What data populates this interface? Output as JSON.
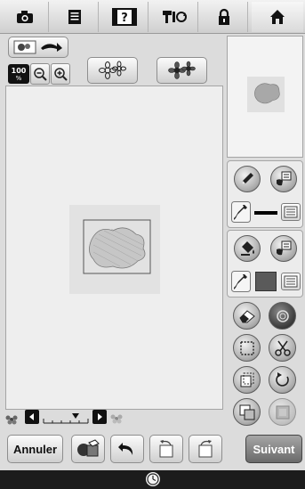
{
  "tabs": [
    {
      "icon": "camera-icon"
    },
    {
      "icon": "document-icon"
    },
    {
      "icon": "help-icon",
      "label": "?"
    },
    {
      "icon": "machine-connect-icon"
    },
    {
      "icon": "lock-icon"
    },
    {
      "icon": "home-icon"
    }
  ],
  "toolbar": {
    "zoom_level": "100",
    "zoom_unit": "%"
  },
  "footer": {
    "cancel_label": "Annuler",
    "next_label": "Suivant"
  },
  "colors": {
    "line_color": "#000000",
    "region_color": "#5a5a5a",
    "accent_button": "#7a7a7a"
  }
}
